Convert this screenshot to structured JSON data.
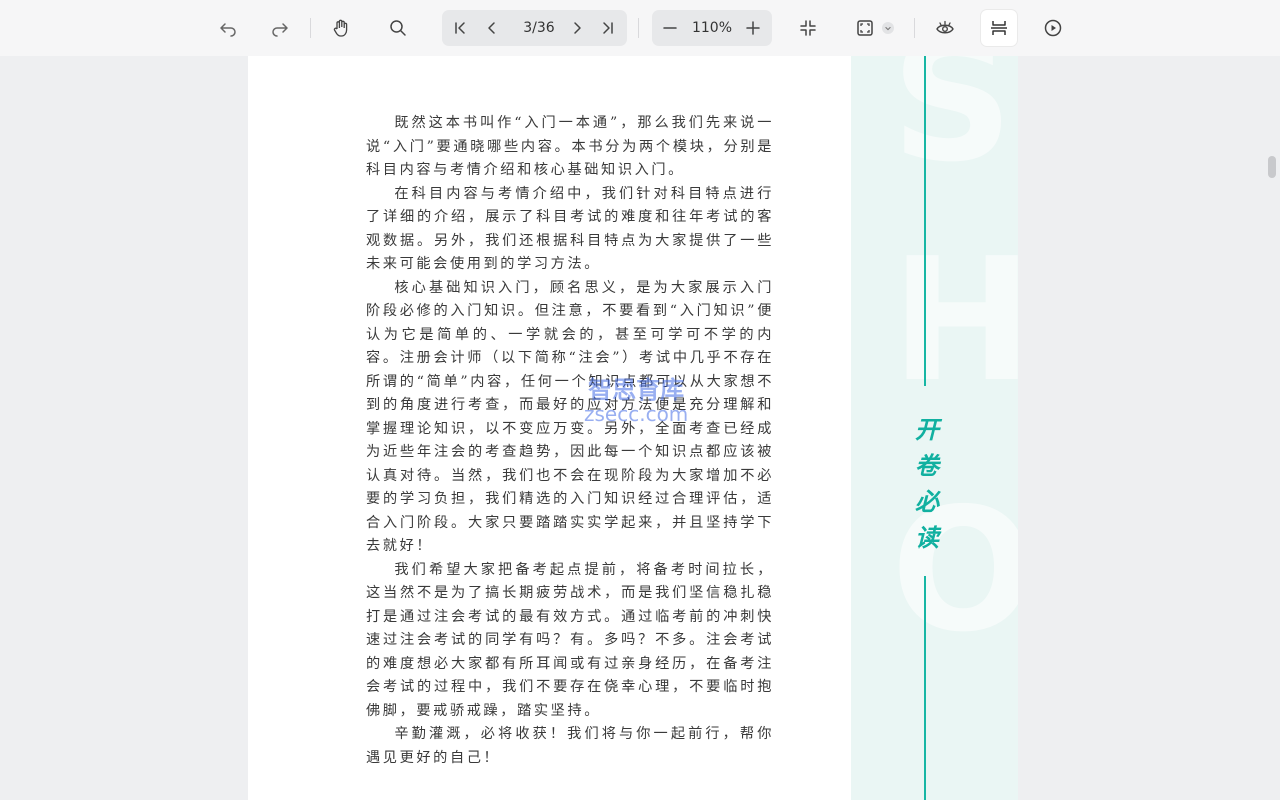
{
  "toolbar": {
    "undo_icon": "undo-icon",
    "redo_icon": "redo-icon",
    "hand_icon": "hand-tool-icon",
    "search_icon": "search-icon",
    "first_page_icon": "first-page-icon",
    "prev_page_icon": "prev-page-icon",
    "page_indicator": "3/36",
    "next_page_icon": "next-page-icon",
    "last_page_icon": "last-page-icon",
    "zoom_out_icon": "minus-icon",
    "zoom_level": "110%",
    "zoom_in_icon": "plus-icon",
    "fit_icon": "fit-page-icon",
    "fullscreen_icon": "fullscreen-icon",
    "dropdown_icon": "chevron-down-icon",
    "eye_icon": "eye-care-icon",
    "page_mode_icon": "page-mode-icon",
    "play_icon": "play-icon"
  },
  "document": {
    "paragraphs": [
      "既然这本书叫作“入门一本通”，那么我们先来说一说“入门”要通晓哪些内容。本书分为两个模块，分别是科目内容与考情介绍和核心基础知识入门。",
      "在科目内容与考情介绍中，我们针对科目特点进行了详细的介绍，展示了科目考试的难度和往年考试的客观数据。另外，我们还根据科目特点为大家提供了一些未来可能会使用到的学习方法。",
      "核心基础知识入门，顾名思义，是为大家展示入门阶段必修的入门知识。但注意，不要看到“入门知识”便认为它是简单的、一学就会的，甚至可学可不学的内容。注册会计师（以下简称“注会”）考试中几乎不存在所谓的“简单”内容，任何一个知识点都可以从大家想不到的角度进行考查，而最好的应对方法便是充分理解和掌握理论知识，以不变应万变。另外，全面考查已经成为近些年注会的考查趋势，因此每一个知识点都应该被认真对待。当然，我们也不会在现阶段为大家增加不必要的学习负担，我们精选的入门知识经过合理评估，适合入门阶段。大家只要踏踏实实学起来，并且坚持学下去就好！",
      "我们希望大家把备考起点提前，将备考时间拉长，这当然不是为了搞长期疲劳战术，而是我们坚信稳扎稳打是通过注会考试的最有效方式。通过临考前的冲刺快速过注会考试的同学有吗？有。多吗？不多。注会考试的难度想必大家都有所耳闻或有过亲身经历，在备考注会考试的过程中，我们不要存在侥幸心理，不要临时抱佛脚，要戒骄戒躁，踏实坚持。",
      "辛勤灌溉，必将收获！我们将与你一起前行，帮你遇见更好的自己！"
    ],
    "side_title": [
      "开",
      "卷",
      "必",
      "读"
    ],
    "watermark_line1": "智思育库",
    "watermark_line2": "zsecc.com"
  },
  "colors": {
    "accent_teal": "#11b0a0",
    "sidebar_bg": "#eaf6f4",
    "toolbar_bg": "#f6f6f7"
  }
}
